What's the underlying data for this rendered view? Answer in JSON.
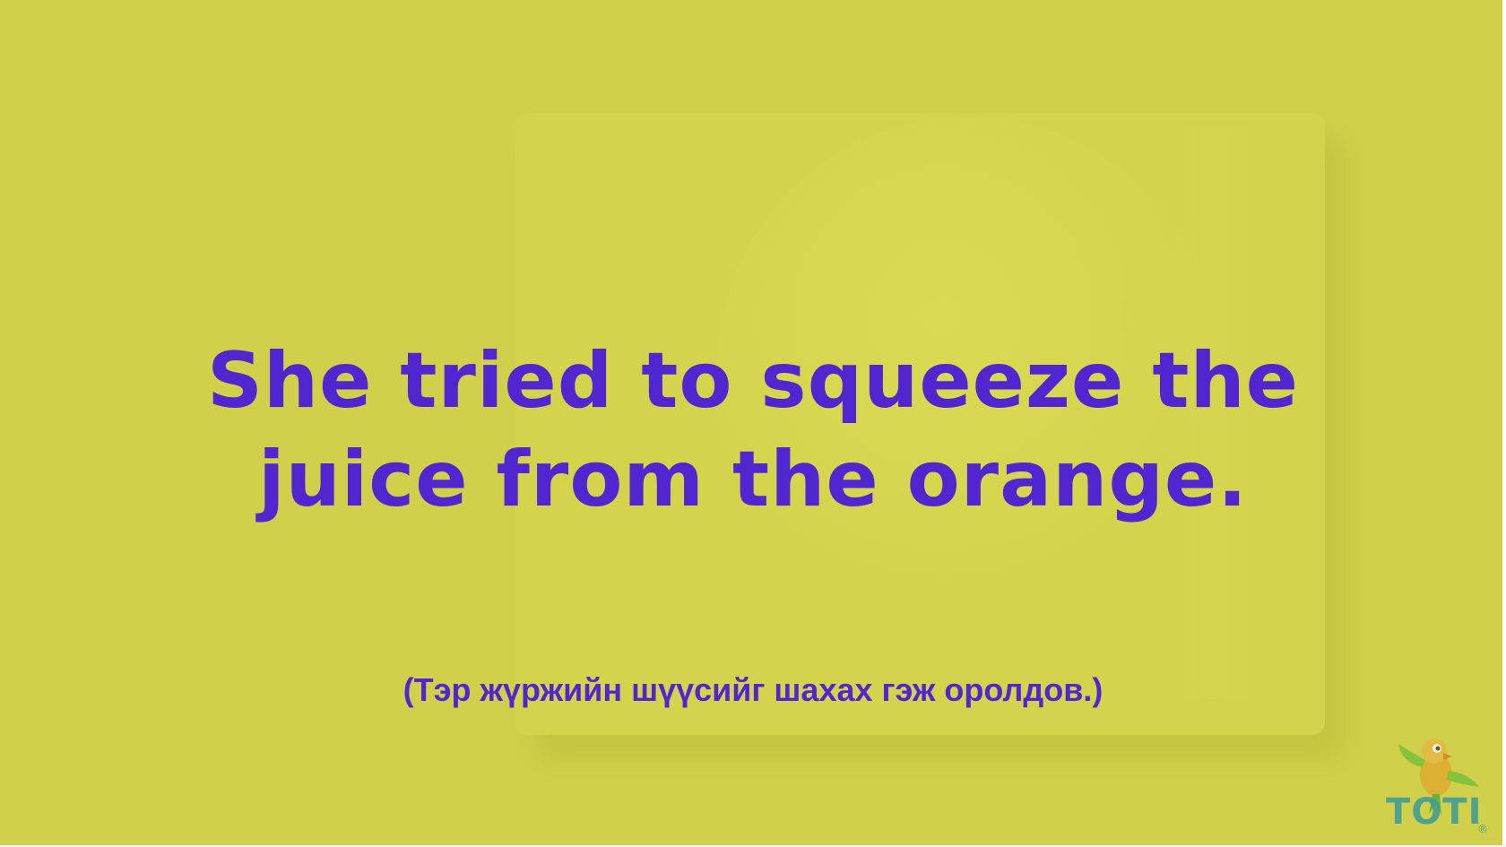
{
  "sentence": {
    "english": "She tried to squeeze the juice from the orange.",
    "translation": "(Тэр жүржийн шүүсийг шахах гэж оролдов.)"
  },
  "logo": {
    "text": "TOTI",
    "mark": "®",
    "icon": "parrot-icon"
  },
  "colors": {
    "background": "#d0d04a",
    "text": "#5126d0",
    "logo": "#3a9a9a"
  }
}
